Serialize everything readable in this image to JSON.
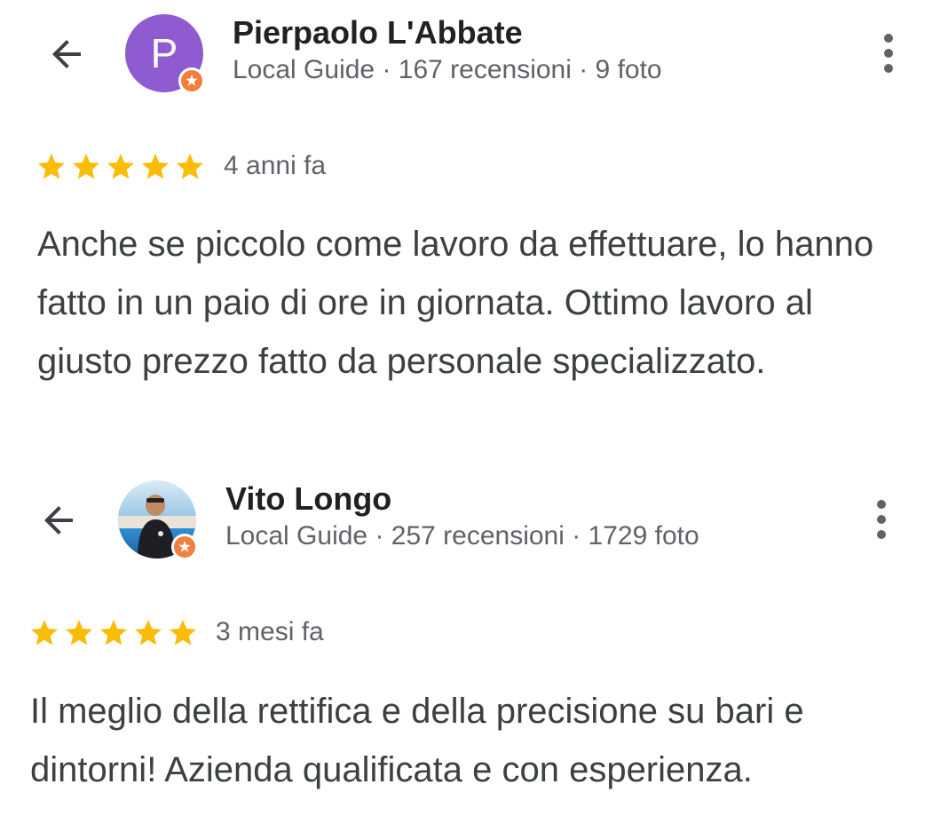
{
  "reviews": [
    {
      "author": "Pierpaolo L'Abbate",
      "avatar_letter": "P",
      "avatar_color": "#8e5bd1",
      "meta": "Local Guide · 167 recensioni · 9 foto",
      "rating": 5,
      "date": "4 anni fa",
      "text": "Anche se piccolo come lavoro da effettuare, lo hanno fatto in un paio di ore in giornata. Ottimo lavoro al giusto prezzo fatto da personale specializzato."
    },
    {
      "author": "Vito Longo",
      "meta": "Local Guide · 257 recensioni · 1729 foto",
      "rating": 5,
      "date": "3 mesi fa",
      "text": "Il meglio della rettifica e della precisione su bari e dintorni! Azienda qualificata e con esperienza."
    }
  ],
  "icons": {
    "back": "arrow-back-icon",
    "more": "more-vert-icon",
    "star": "star-icon",
    "badge": "local-guide-badge-icon"
  },
  "colors": {
    "star": "#fbbc04",
    "badge": "#f0803c",
    "avatar_p": "#8e5bd1"
  }
}
